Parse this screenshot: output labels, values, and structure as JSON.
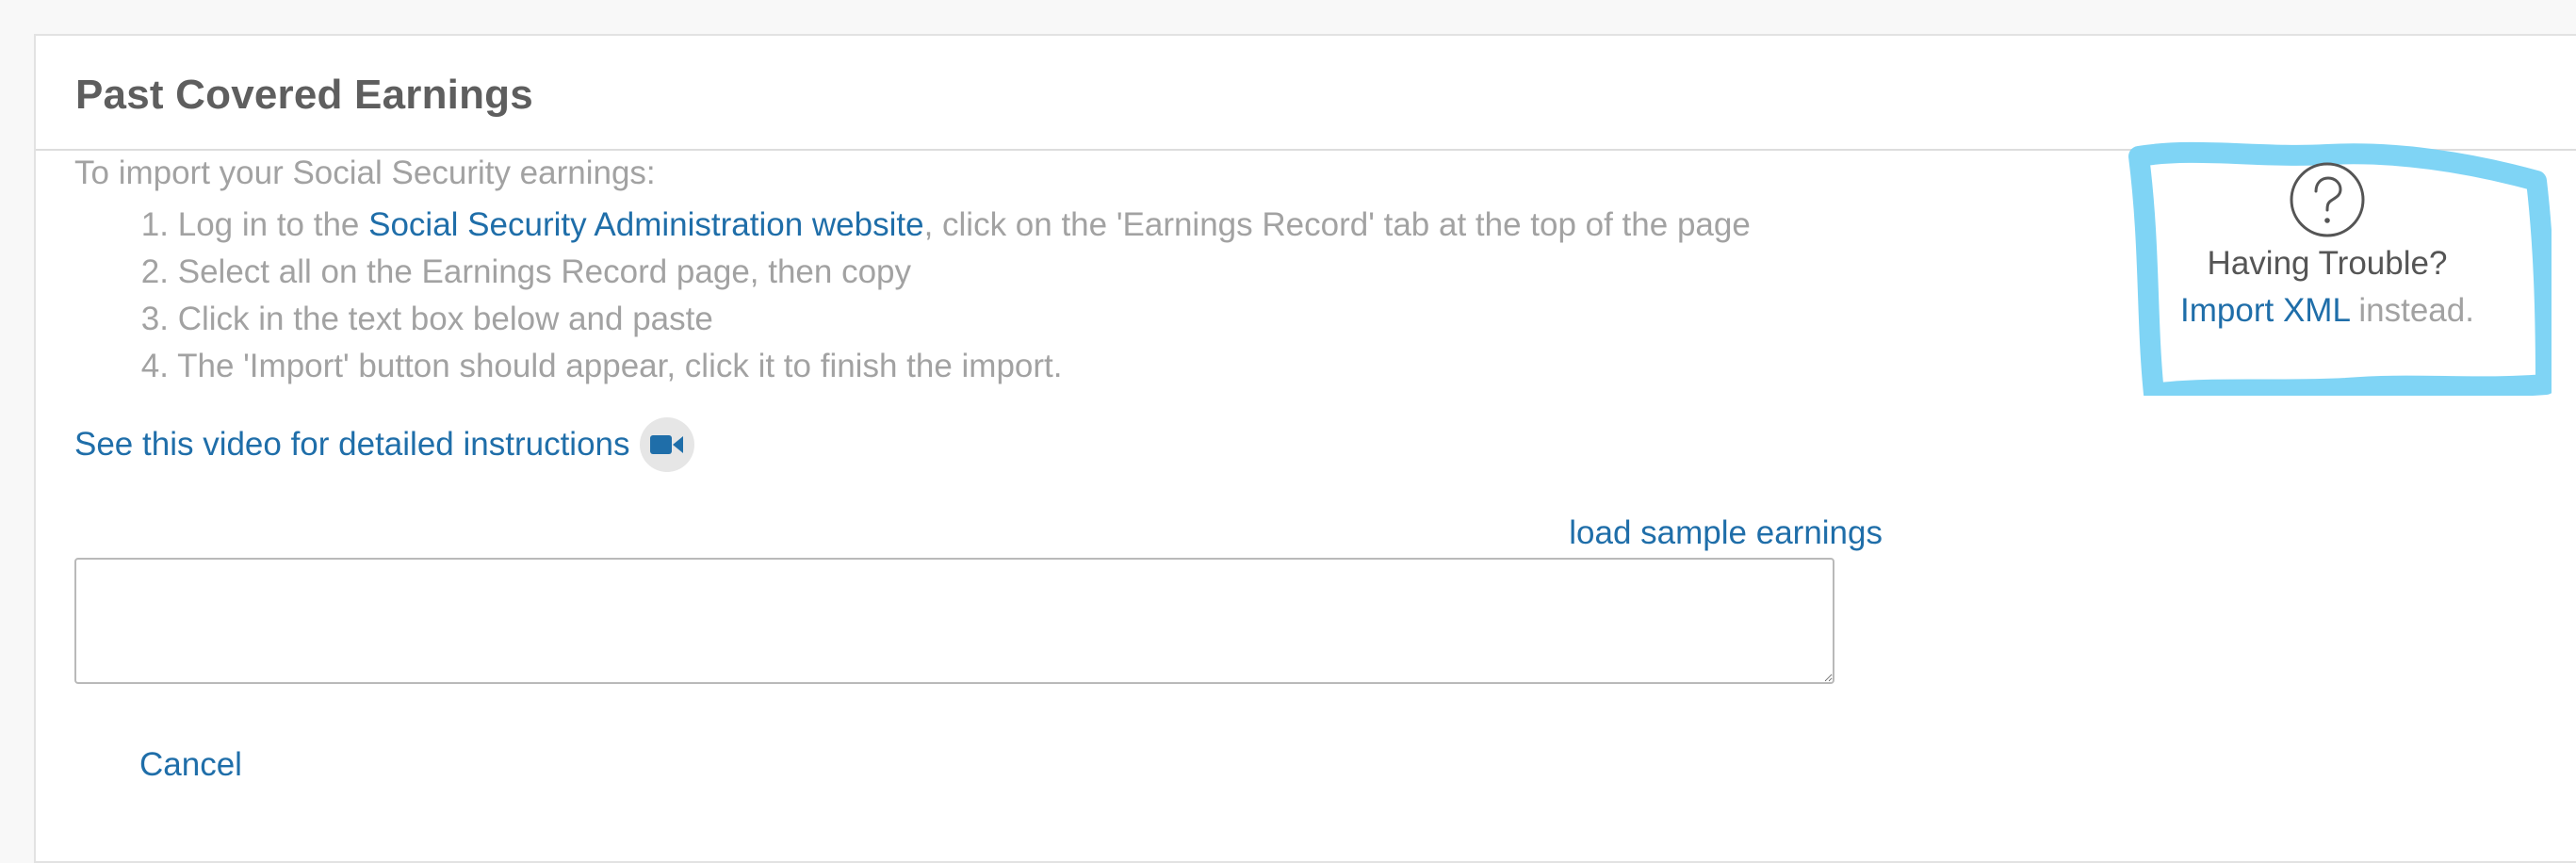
{
  "section": {
    "title": "Past Covered Earnings"
  },
  "instructions": {
    "intro": "To import your Social Security earnings:",
    "steps": [
      {
        "number": "1.",
        "text_before": "Log in to the ",
        "link": "Social Security Administration website",
        "text_after": ", click on the 'Earnings Record' tab at the top of the page"
      },
      {
        "number": "2.",
        "text": "Select all on the Earnings Record page, then copy"
      },
      {
        "number": "3.",
        "text": "Click in the text box below and paste"
      },
      {
        "number": "4.",
        "text": "The 'Import' button should appear, click it to finish the import."
      }
    ],
    "video_link": "See this video for detailed instructions",
    "video_icon": "video-camera-icon"
  },
  "paste": {
    "load_sample_link": "load sample earnings",
    "textarea_value": "",
    "textarea_placeholder": ""
  },
  "actions": {
    "cancel_label": "Cancel"
  },
  "help": {
    "icon": "question-circle-icon",
    "title": "Having Trouble?",
    "link": "Import XML",
    "suffix": " instead.",
    "highlight_color": "#7fd4f5"
  },
  "colors": {
    "link": "#1f6ea9",
    "muted_text": "#a2a2a2",
    "title_text": "#5e5e5e"
  }
}
